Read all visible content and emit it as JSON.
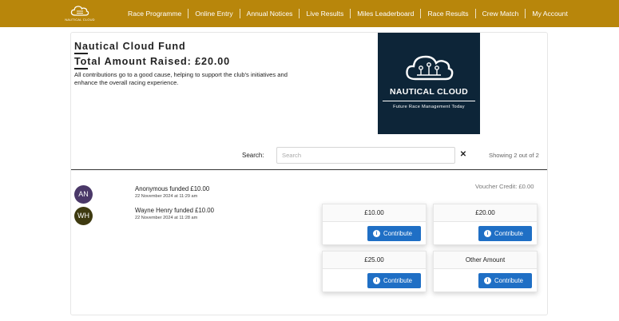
{
  "header": {
    "logo_text": "NAUTICAL CLOUD",
    "nav": [
      "Race Programme",
      "Online Entry",
      "Annual Notices",
      "Live Results",
      "Miles Leaderboard",
      "Race Results",
      "Crew Match",
      "My Account"
    ],
    "bg_color": "#b8860b"
  },
  "fund": {
    "title": "Nautical Cloud Fund",
    "total_label": "Total Amount Raised: £20.00",
    "description": "All contributions go to a good cause, helping to support the club's initiatives and enhance the overall racing experience."
  },
  "brand": {
    "name": "NAUTICAL CLOUD",
    "tagline": "Future Race Management Today",
    "bg_color": "#0d2538"
  },
  "search": {
    "label": "Search:",
    "placeholder": "Search",
    "value": "",
    "clear_glyph": "✕",
    "showing": "Showing 2 out of 2"
  },
  "contributors": [
    {
      "initials": "AN",
      "name": "Anonymous funded £10.00",
      "date": "22 November 2024 at 11:29 am",
      "color": "#4a3868"
    },
    {
      "initials": "WH",
      "name": "Wayne Henry funded £10.00",
      "date": "22 November 2024 at 11:28 am",
      "color": "#3e3a10"
    }
  ],
  "voucher": "Voucher Credit: £0.00",
  "tiles": [
    {
      "amount": "£10.00",
      "button": "Contribute"
    },
    {
      "amount": "£20.00",
      "button": "Contribute"
    },
    {
      "amount": "£25.00",
      "button": "Contribute"
    },
    {
      "amount": "Other Amount",
      "button": "Contribute"
    }
  ],
  "button_color": "#1f6fc5",
  "button_icon": "info-icon"
}
